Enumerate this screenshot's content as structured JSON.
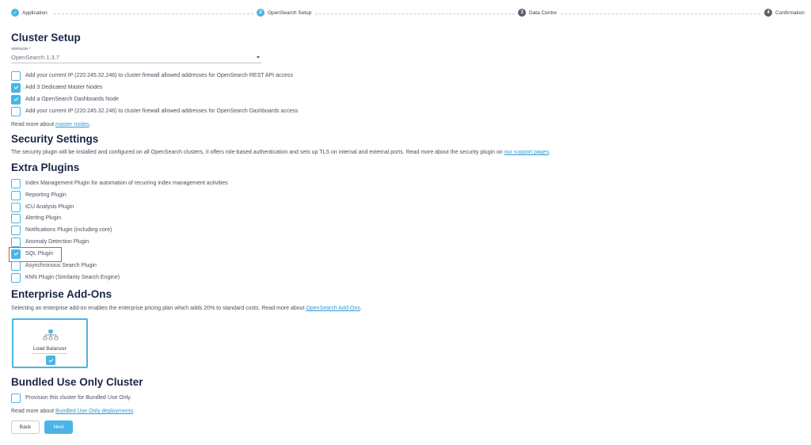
{
  "stepper": {
    "steps": [
      {
        "label": "Application",
        "marker": "✓",
        "state": "done"
      },
      {
        "label": "OpenSearch Setup",
        "marker": "2",
        "state": "active"
      },
      {
        "label": "Data Centre",
        "marker": "3",
        "state": "todo"
      },
      {
        "label": "Confirmation",
        "marker": "4",
        "state": "todo"
      }
    ]
  },
  "cluster_setup": {
    "title": "Cluster Setup",
    "version_label": "VERSION *",
    "version_value": "OpenSearch 1.3.7",
    "options": [
      {
        "label": "Add your current IP (220.245.32.246) to cluster firewall allowed addresses for OpenSearch REST API access",
        "checked": false
      },
      {
        "label": "Add 3 Dedicated Master Nodes",
        "checked": true
      },
      {
        "label": "Add a OpenSearch Dashboards Node",
        "checked": true
      },
      {
        "label": "Add your current IP (220.245.32.246) to cluster firewall allowed addresses for OpenSearch Dashboards access",
        "checked": false
      }
    ],
    "read_more_prefix": "Read more about ",
    "read_more_link": "master nodes",
    "read_more_suffix": "."
  },
  "security": {
    "title": "Security Settings",
    "text": "The security plugin will be installed and configured on all OpenSearch clusters, it offers role-based authentication and sets up TLS on internal and external ports. Read more about the security plugin on ",
    "link": "our support pages",
    "suffix": "."
  },
  "extra_plugins": {
    "title": "Extra Plugins",
    "options": [
      {
        "label": "Index Management Plugin for automation of recurring index management activities",
        "checked": false
      },
      {
        "label": "Reporting Plugin",
        "checked": false
      },
      {
        "label": "ICU Analysis Plugin",
        "checked": false
      },
      {
        "label": "Alerting Plugin",
        "checked": false
      },
      {
        "label": "Notifications Plugin (including core)",
        "checked": false
      },
      {
        "label": "Anomaly Detection Plugin",
        "checked": false
      },
      {
        "label": "SQL Plugin",
        "checked": true
      },
      {
        "label": "Asynchronous Search Plugin",
        "checked": false
      },
      {
        "label": "KNN Plugin (Similarity Search Engine)",
        "checked": false
      }
    ]
  },
  "enterprise": {
    "title": "Enterprise Add-Ons",
    "text": "Selecting an enterprise add-on enables the enterprise pricing plan which adds 20% to standard costs. Read more about ",
    "link": "OpenSearch Add-Ons",
    "suffix": ".",
    "card_label": "Load Balancer",
    "card_checked": true
  },
  "bundled": {
    "title": "Bundled Use Only Cluster",
    "option_label": "Provision this cluster for Bundled Use Only.",
    "option_checked": false,
    "read_more_prefix": "Read more about ",
    "read_more_link": "Bundled Use Only deployments",
    "read_more_suffix": "."
  },
  "buttons": {
    "back": "Back",
    "next": "Next"
  },
  "colors": {
    "accent": "#4bb4e6",
    "heading": "#1c2447",
    "highlight": "#e4532a"
  }
}
